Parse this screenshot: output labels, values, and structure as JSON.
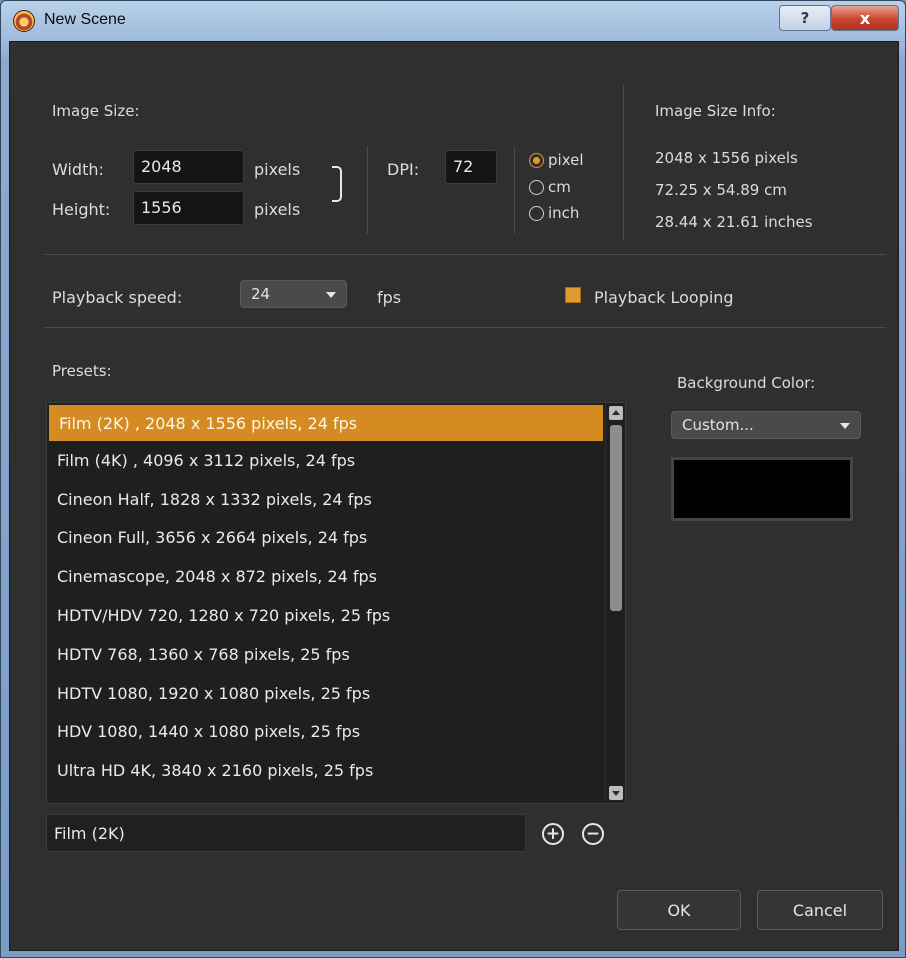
{
  "window": {
    "title": "New Scene",
    "help_label": "?",
    "close_label": "x"
  },
  "image_size": {
    "heading": "Image Size:",
    "width_label": "Width:",
    "width_value": "2048",
    "width_unit": "pixels",
    "height_label": "Height:",
    "height_value": "1556",
    "height_unit": "pixels",
    "dpi_label": "DPI:",
    "dpi_value": "72",
    "units": [
      {
        "label": "pixel",
        "selected": true
      },
      {
        "label": "cm",
        "selected": false
      },
      {
        "label": "inch",
        "selected": false
      }
    ]
  },
  "info": {
    "heading": "Image Size Info:",
    "lines": [
      "2048 x 1556 pixels",
      "72.25 x 54.89 cm",
      "28.44 x 21.61 inches"
    ]
  },
  "playback": {
    "label": "Playback speed:",
    "speed_value": "24",
    "unit": "fps",
    "looping_label": "Playback Looping",
    "looping_checked": true
  },
  "presets": {
    "heading": "Presets:",
    "items": [
      "Film (2K) , 2048 x 1556 pixels, 24 fps",
      "Film (4K) , 4096 x 3112 pixels, 24 fps",
      "Cineon Half, 1828 x 1332 pixels, 24 fps",
      "Cineon Full, 3656 x 2664 pixels, 24 fps",
      "Cinemascope, 2048 x 872 pixels, 24 fps",
      "HDTV/HDV 720, 1280 x 720 pixels, 25 fps",
      "HDTV 768, 1360 x 768 pixels, 25 fps",
      "HDTV 1080, 1920 x 1080 pixels, 25 fps",
      "HDV 1080, 1440 x 1080 pixels, 25 fps",
      "Ultra HD 4K, 3840 x 2160 pixels, 25 fps"
    ],
    "selected_index": 0,
    "name_value": "Film (2K)"
  },
  "background": {
    "heading": "Background Color:",
    "mode_value": "Custom...",
    "color": "#000000"
  },
  "buttons": {
    "ok": "OK",
    "cancel": "Cancel"
  },
  "colors": {
    "accent": "#d48b22",
    "panel": "#2f2f2f"
  }
}
